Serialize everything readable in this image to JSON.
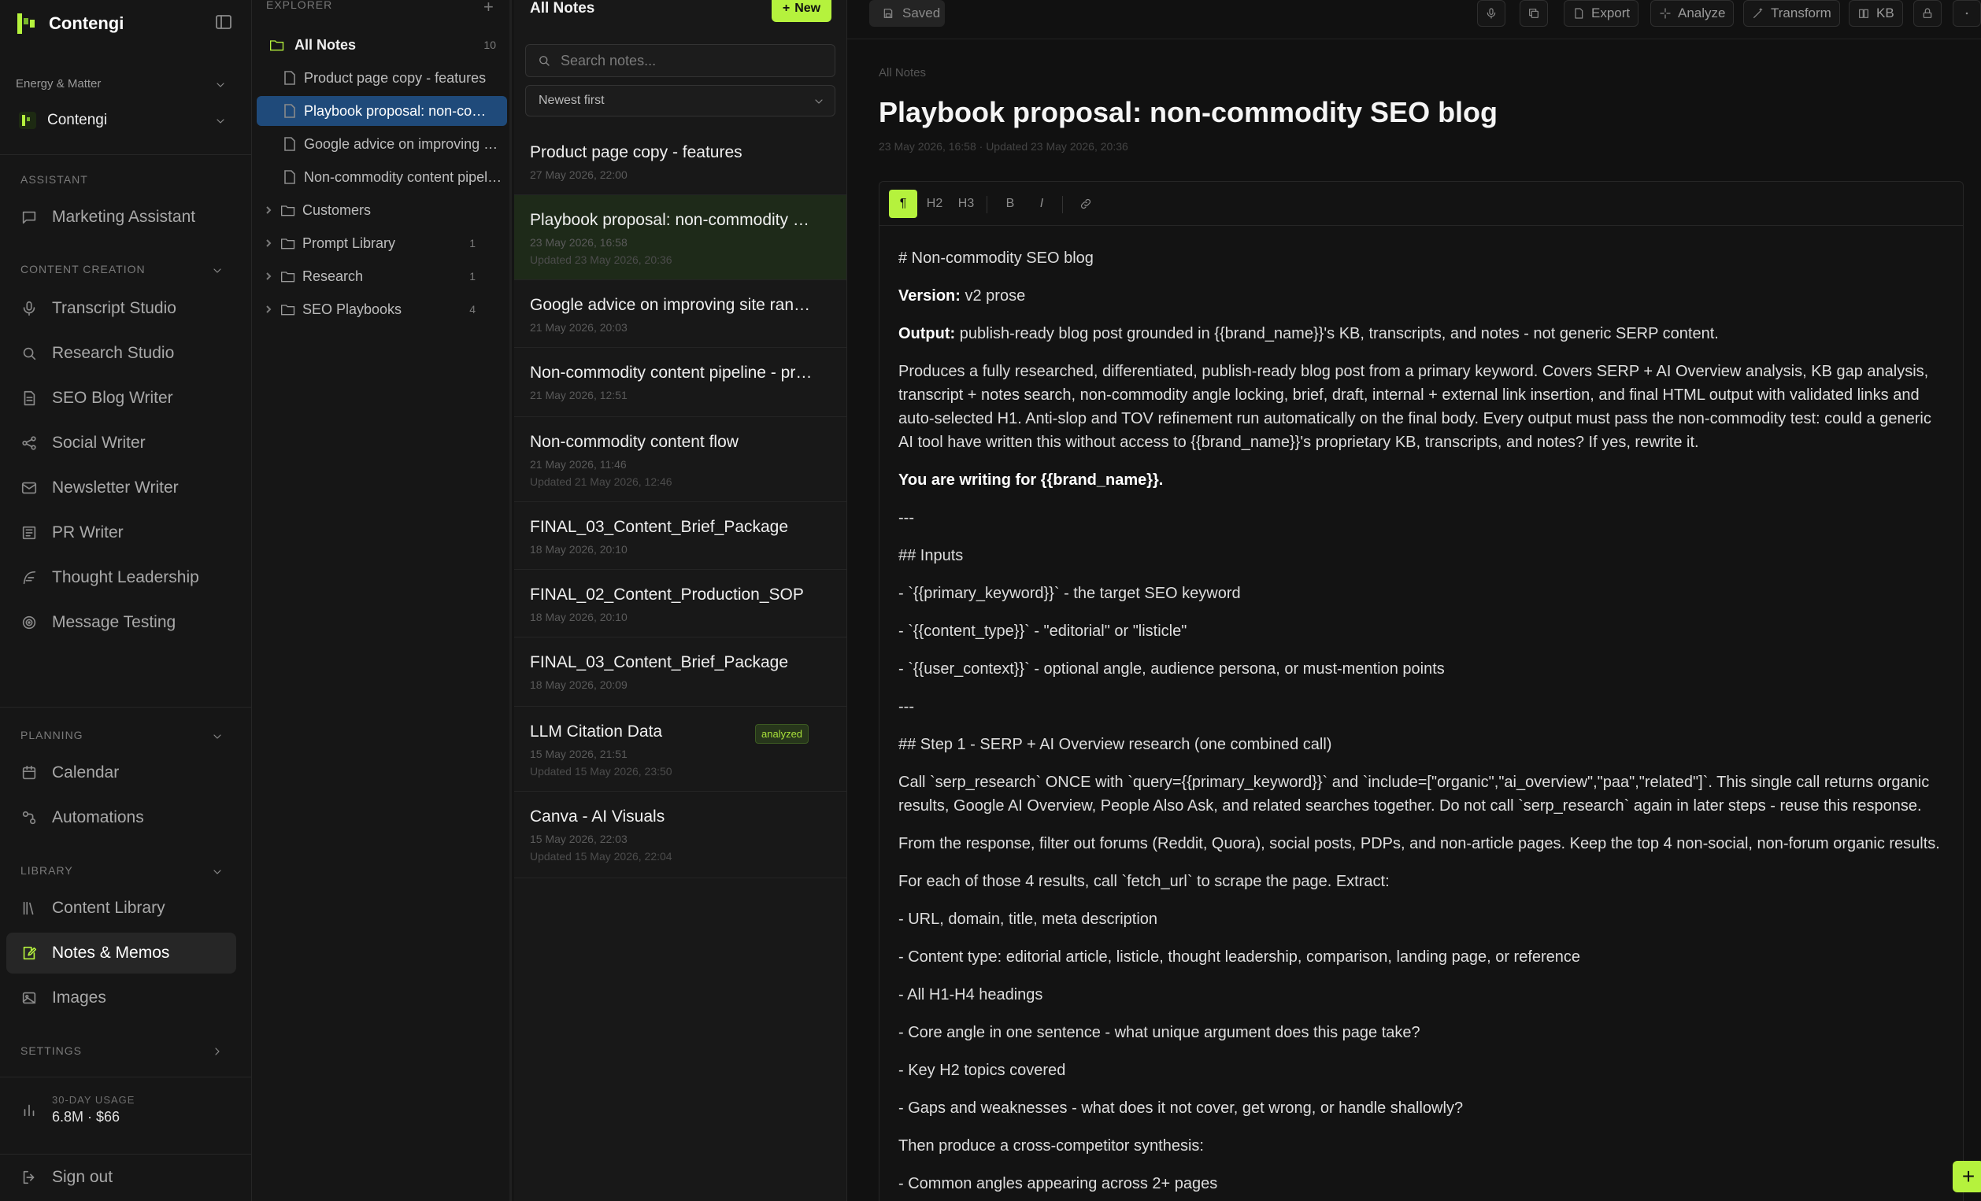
{
  "sidebar": {
    "brand": "Contengi",
    "workspace_label": "Energy & Matter",
    "workspace_name": "Contengi",
    "sections": {
      "assistant": "ASSISTANT",
      "content_creation": "CONTENT CREATION",
      "planning": "PLANNING",
      "library": "LIBRARY",
      "settings": "SETTINGS"
    },
    "items": [
      {
        "label": "Marketing Assistant",
        "icon": "chat-icon"
      },
      {
        "label": "Transcript Studio",
        "icon": "mic-icon"
      },
      {
        "label": "Research Studio",
        "icon": "search-icon"
      },
      {
        "label": "SEO Blog Writer",
        "icon": "document-icon"
      },
      {
        "label": "Social Writer",
        "icon": "share-icon"
      },
      {
        "label": "Newsletter Writer",
        "icon": "mail-icon"
      },
      {
        "label": "PR Writer",
        "icon": "newspaper-icon"
      },
      {
        "label": "Thought Leadership",
        "icon": "feather-icon"
      },
      {
        "label": "Message Testing",
        "icon": "target-icon"
      },
      {
        "label": "Calendar",
        "icon": "calendar-icon"
      },
      {
        "label": "Automations",
        "icon": "workflow-icon"
      },
      {
        "label": "Content Library",
        "icon": "library-icon"
      },
      {
        "label": "Notes & Memos",
        "icon": "note-edit-icon"
      },
      {
        "label": "Images",
        "icon": "image-icon"
      }
    ],
    "usage_label": "30-DAY USAGE",
    "usage_value": "6.8M · $66",
    "sign_out": "Sign out"
  },
  "explorer": {
    "title": "EXPLORER",
    "all_notes": "All Notes",
    "all_count": "10",
    "files": [
      "Product page copy - features",
      "Playbook proposal: non-commodity SEO blog",
      "Google advice on improving site rankings",
      "Non-commodity content pipeline"
    ],
    "folders": [
      {
        "name": "Customers",
        "count": ""
      },
      {
        "name": "Prompt Library",
        "count": "1"
      },
      {
        "name": "Research",
        "count": "1"
      },
      {
        "name": "SEO Playbooks",
        "count": "4"
      }
    ]
  },
  "notes": {
    "title": "All Notes",
    "new_label": "New",
    "search_placeholder": "Search notes...",
    "sort": "Newest first",
    "items": [
      {
        "title": "Product page copy - features",
        "date": "27 May 2026, 22:00",
        "updated": ""
      },
      {
        "title": "Playbook proposal: non-commodity SEO blog",
        "date": "23 May 2026, 16:58",
        "updated": "Updated 23 May 2026, 20:36"
      },
      {
        "title": "Google advice on improving site rankings",
        "date": "21 May 2026, 20:03",
        "updated": ""
      },
      {
        "title": "Non-commodity content pipeline - process",
        "date": "21 May 2026, 12:51",
        "updated": ""
      },
      {
        "title": "Non-commodity content flow",
        "date": "21 May 2026, 11:46",
        "updated": "Updated 21 May 2026, 12:46"
      },
      {
        "title": "FINAL_03_Content_Brief_Package",
        "date": "18 May 2026, 20:10",
        "updated": ""
      },
      {
        "title": "FINAL_02_Content_Production_SOP",
        "date": "18 May 2026, 20:10",
        "updated": ""
      },
      {
        "title": "FINAL_03_Content_Brief_Package",
        "date": "18 May 2026, 20:09",
        "updated": ""
      },
      {
        "title": "LLM Citation Data",
        "date": "15 May 2026, 21:51",
        "updated": "Updated 15 May 2026, 23:50",
        "badge": "analyzed"
      },
      {
        "title": "Canva - AI Visuals",
        "date": "15 May 2026, 22:03",
        "updated": "Updated 15 May 2026, 22:04"
      }
    ]
  },
  "editor": {
    "saved": "Saved",
    "buttons": {
      "export": "Export",
      "analyze": "Analyze",
      "transform": "Transform",
      "kb": "KB"
    },
    "breadcrumb": "All Notes",
    "title": "Playbook proposal: non-commodity SEO blog",
    "meta": "23 May 2026, 16:58  · Updated 23 May 2026, 20:36",
    "toolbar": {
      "paragraph": "¶",
      "h2": "H2",
      "h3": "H3",
      "bold": "B",
      "italic": "I"
    },
    "lines": [
      "# Non-commodity SEO blog",
      "Produces a fully researched, differentiated, publish-ready blog post from a primary keyword. Covers SERP + AI Overview analysis, KB gap analysis, transcript + notes search, non-commodity angle locking, brief, draft, internal + external link insertion, and final HTML output with validated links and auto-selected H1. Anti-slop and TOV refinement run automatically on the final body. Every output must pass the non-commodity test: could a generic AI tool have written this without access to {{brand_name}}'s proprietary KB, transcripts, and notes? If yes, rewrite it.",
      "You are writing for {{brand_name}}.",
      "---",
      "## Inputs",
      "- `{{primary_keyword}}` - the target SEO keyword",
      "- `{{content_type}}` - \"editorial\" or \"listicle\"",
      "- `{{user_context}}` - optional angle, audience persona, or must-mention points",
      "---",
      "## Step 1 - SERP + AI Overview research (one combined call)",
      "Call `serp_research` ONCE with `query={{primary_keyword}}` and `include=[\"organic\",\"ai_overview\",\"paa\",\"related\"]`. This single call returns organic results, Google AI Overview, People Also Ask, and related searches together. Do not call `serp_research` again in later steps - reuse this response.",
      "From the response, filter out forums (Reddit, Quora), social posts, PDPs, and non-article pages. Keep the top 4 non-social, non-forum organic results.",
      "For each of those 4 results, call `fetch_url` to scrape the page. Extract:",
      "- URL, domain, title, meta description",
      "- Content type: editorial article, listicle, thought leadership, comparison, landing page, or reference",
      "- All H1-H4 headings",
      "- Core angle in one sentence - what unique argument does this page take?",
      "- Key H2 topics covered",
      "- Gaps and weaknesses - what does it not cover, get wrong, or handle shallowly?",
      "Then produce a cross-competitor synthesis:",
      "- Common angles appearing across 2+ pages"
    ],
    "version_label": "Version:",
    "version_value": "v2 prose",
    "output_label": "Output:",
    "output_value": "publish-ready blog post grounded in {{brand_name}}'s KB, transcripts, and notes - not generic SERP content."
  },
  "colors": {
    "accent": "#b5f23d",
    "selected_tree": "#1f4a7a"
  }
}
